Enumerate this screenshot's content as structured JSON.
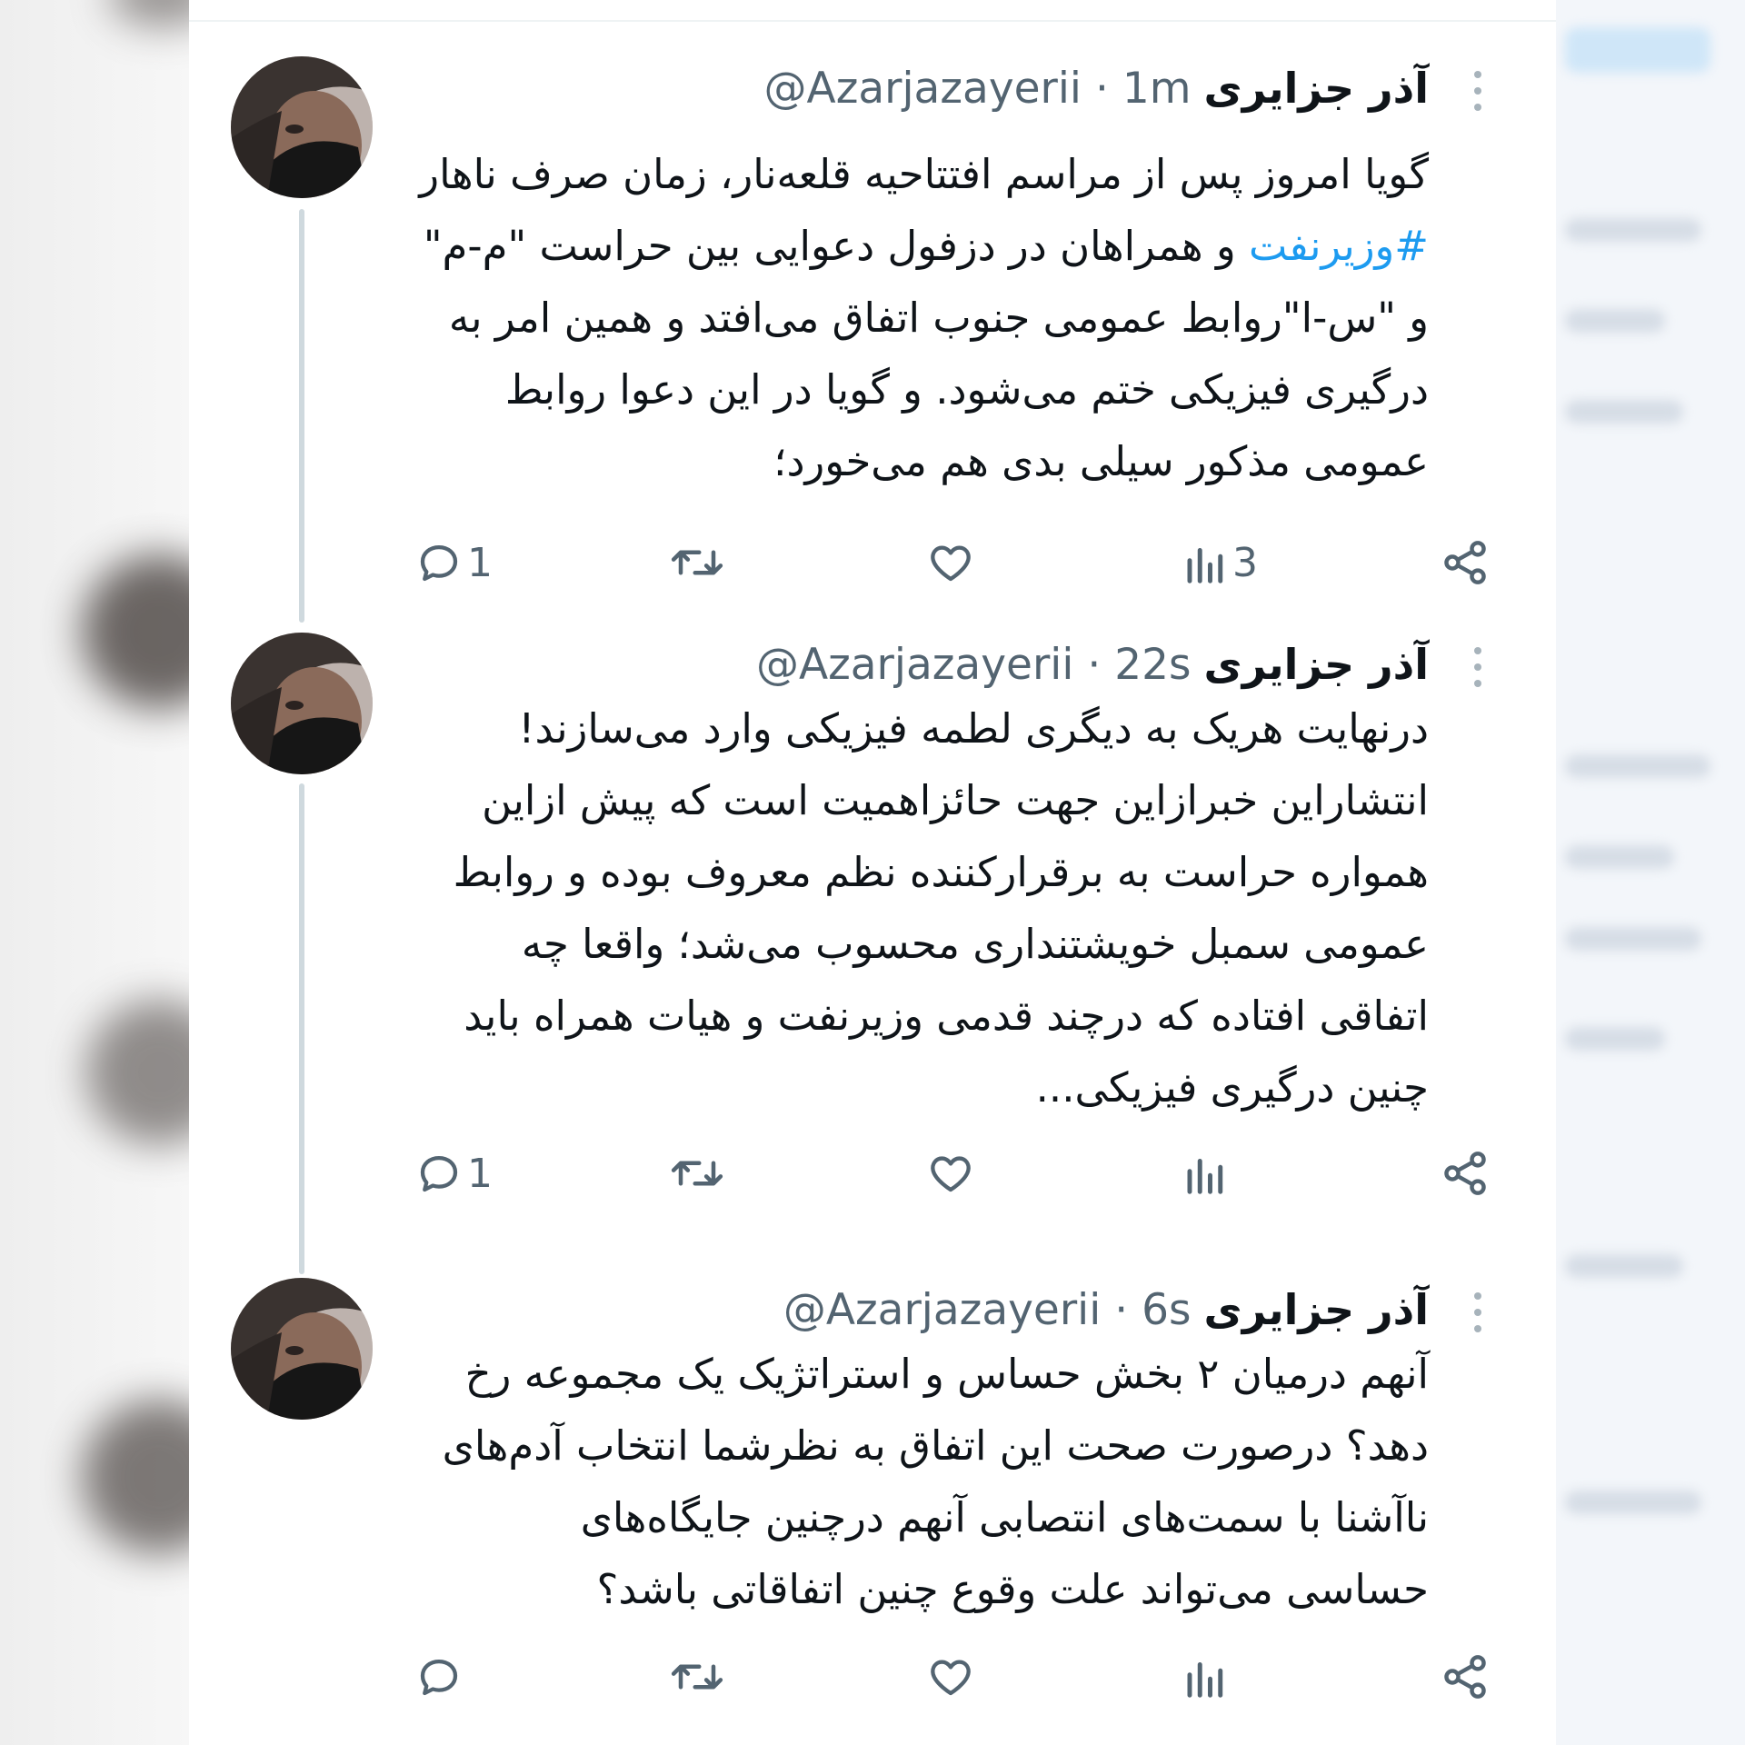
{
  "tweets": [
    {
      "author": {
        "name": "آذر جزایری",
        "handle": "@Azarjazayerii"
      },
      "separator": "·",
      "time": "1m",
      "lines": [
        "گویا امروز پس از مراسم افتتاحیه قلعه‌نار، زمان صرف ناهار",
        "و همراهان در دزفول دعوایی بین حراست \"م-م\"",
        "و \"س-ا\"روابط عمومی جنوب اتفاق می‌افتد و همین امر به",
        "درگیری فیزیکی ختم می‌شود. و گویا در این دعوا روابط",
        "عمومی مذکور سیلی بدی هم می‌خورد؛"
      ],
      "hashtag": "#وزیرنفت",
      "actions": {
        "reply_count": "1",
        "retweet_count": "",
        "like_count": "",
        "views_count": "3"
      }
    },
    {
      "author": {
        "name": "آذر جزایری",
        "handle": "@Azarjazayerii"
      },
      "separator": "·",
      "time": "22s",
      "lines": [
        "درنهایت هریک به دیگری لطمه فیزیکی وارد می‌سازند!",
        "انتشاراین خبرازاین جهت حائزاهمیت است که پیش ازاین",
        "همواره حراست به برقرارکننده نظم معروف بوده و روابط",
        "عمومی سمبل خویشتنداری محسوب می‌شد؛ واقعا چه",
        "اتفاقی افتاده که درچند قدمی وزیرنفت و هیات همراه باید",
        "چنین درگیری فیزیکی..."
      ],
      "actions": {
        "reply_count": "1",
        "retweet_count": "",
        "like_count": "",
        "views_count": ""
      }
    },
    {
      "author": {
        "name": "آذر جزایری",
        "handle": "@Azarjazayerii"
      },
      "separator": "·",
      "time": "6s",
      "lines": [
        "آنهم درمیان ۲ بخش حساس و استراتژیک یک مجموعه رخ",
        "دهد؟ درصورت صحت این اتفاق به نظرشما انتخاب آدم‌های",
        "ناآشنا با سمت‌های انتصابی آنهم درچنین جایگاه‌های",
        "حساسی می‌تواند علت وقوع چنین اتفاقاتی باشد؟"
      ],
      "actions": {
        "reply_count": "",
        "retweet_count": "",
        "like_count": "",
        "views_count": ""
      }
    }
  ],
  "icons": {
    "reply": "reply-icon",
    "retweet": "retweet-icon",
    "like": "heart-icon",
    "views": "views-icon",
    "share": "share-icon",
    "more": "more-options-icon"
  },
  "colors": {
    "text": "#0f1419",
    "secondary": "#536471",
    "hashtag": "#1d9bf0",
    "thread_line": "#cfd9de",
    "icon": "#536471"
  }
}
